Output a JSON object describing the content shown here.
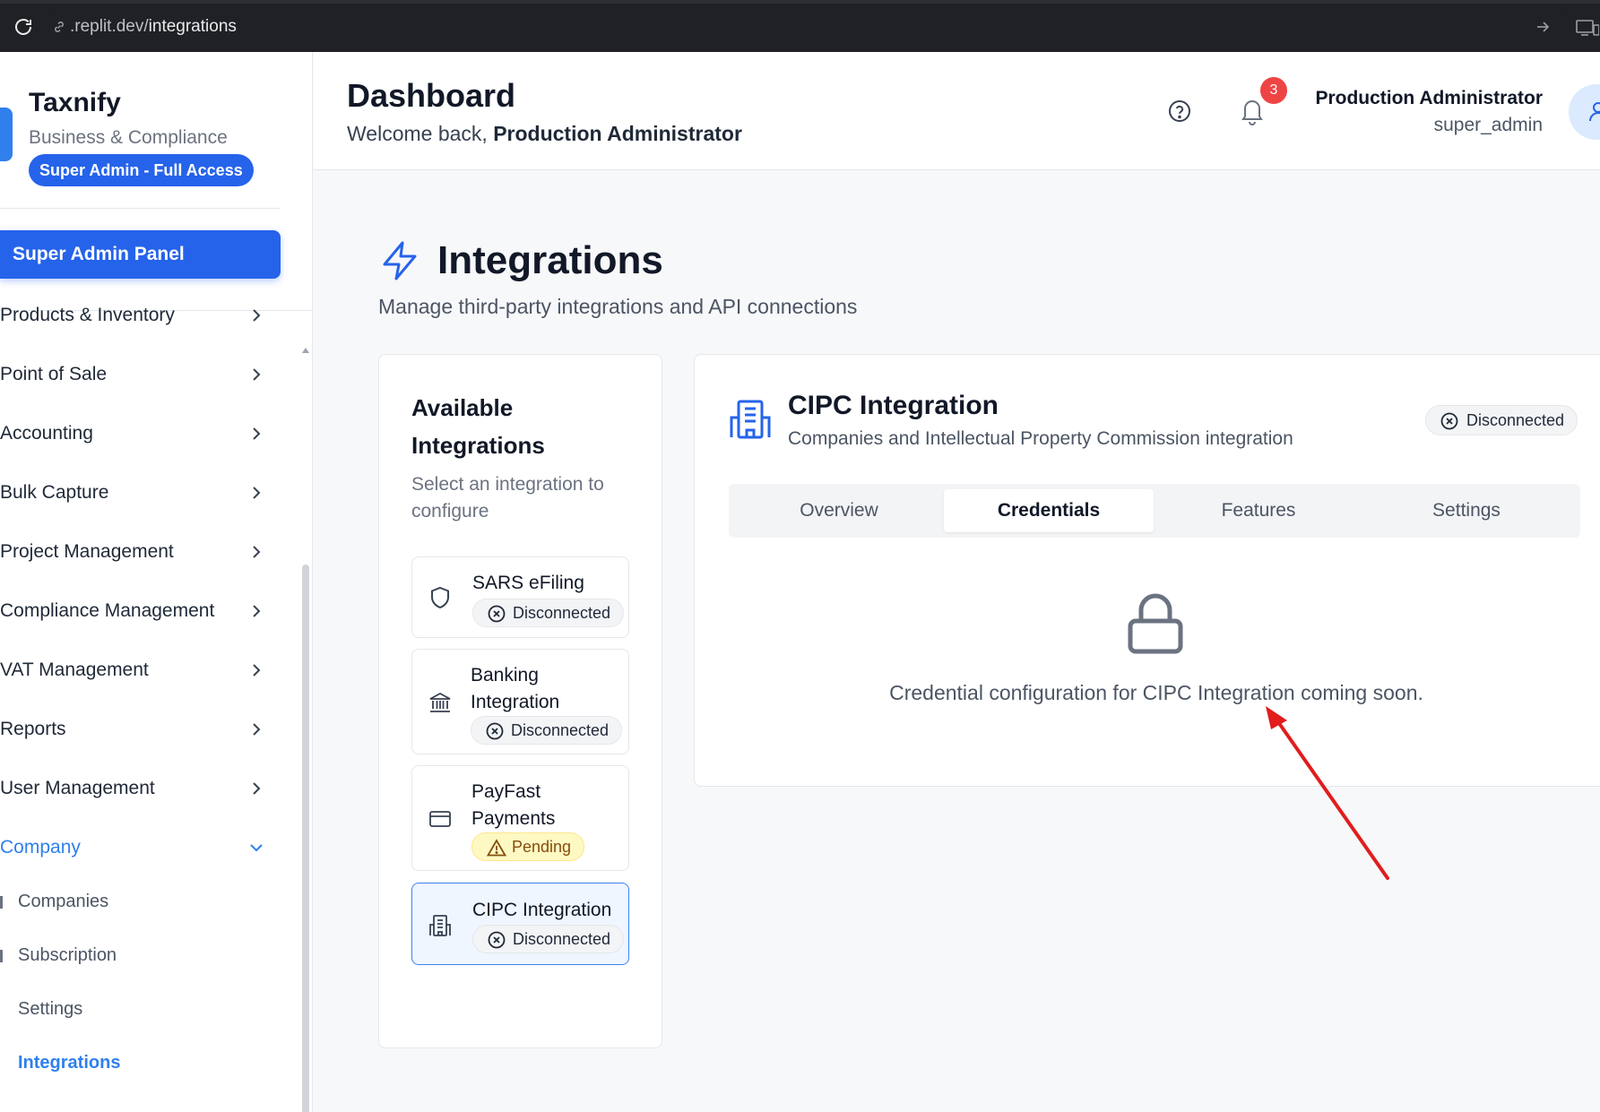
{
  "browser": {
    "url_domain": ".replit.dev/",
    "url_path": "integrations"
  },
  "sidebar": {
    "brand_name": "Taxnify",
    "brand_sub": "Business & Compliance",
    "role_badge": "Super Admin - Full Access",
    "admin_panel_label": "Super Admin Panel",
    "nav_items": [
      {
        "label": "Products & Inventory"
      },
      {
        "label": "Point of Sale"
      },
      {
        "label": "Accounting"
      },
      {
        "label": "Bulk Capture"
      },
      {
        "label": "Project Management"
      },
      {
        "label": "Compliance Management"
      },
      {
        "label": "VAT Management"
      },
      {
        "label": "Reports"
      },
      {
        "label": "User Management"
      },
      {
        "label": "Company"
      }
    ],
    "company_sub_items": [
      {
        "label": "Companies"
      },
      {
        "label": "Subscription"
      },
      {
        "label": "Settings"
      },
      {
        "label": "Integrations"
      }
    ],
    "accent_color": "#2563eb"
  },
  "header": {
    "title": "Dashboard",
    "welcome_prefix": "Welcome back, ",
    "welcome_name": "Production Administrator",
    "notification_count": "3",
    "user_name": "Production Administrator",
    "user_role": "super_admin"
  },
  "main": {
    "title": "Integrations",
    "subtitle": "Manage third-party integrations and API connections",
    "list": {
      "title": "Available Integrations",
      "subtitle": "Select an integration to configure",
      "items": [
        {
          "name": "SARS eFiling",
          "status": "Disconnected",
          "icon": "shield-icon"
        },
        {
          "name": "Banking Integration",
          "status": "Disconnected",
          "icon": "bank-icon"
        },
        {
          "name": "PayFast Payments",
          "status": "Pending",
          "icon": "credit-card-icon"
        },
        {
          "name": "CIPC Integration",
          "status": "Disconnected",
          "icon": "building-icon",
          "selected": true
        }
      ]
    },
    "detail": {
      "title": "CIPC Integration",
      "subtitle": "Companies and Intellectual Property Commission integration",
      "status": "Disconnected",
      "tabs": [
        {
          "label": "Overview"
        },
        {
          "label": "Credentials",
          "active": true
        },
        {
          "label": "Features"
        },
        {
          "label": "Settings"
        }
      ],
      "message": "Credential configuration for CIPC Integration coming soon."
    }
  },
  "colors": {
    "primary": "#2563eb",
    "danger_badge": "#ef4444",
    "pending_bg": "#fef9c3",
    "annotation_arrow": "#e11d1d"
  }
}
